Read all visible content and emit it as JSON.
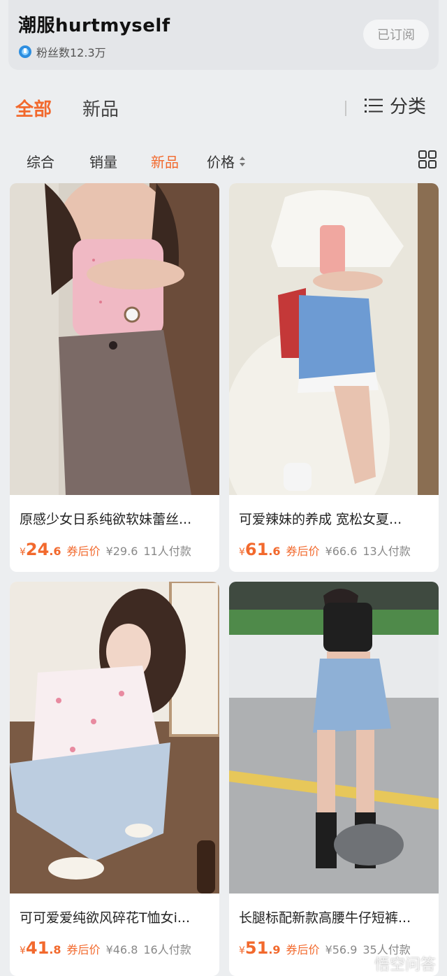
{
  "shop": {
    "name": "潮服hurtmyself",
    "fans_label": "粉丝数12.3万",
    "subscribe_label": "已订阅"
  },
  "tabs": {
    "all": "全部",
    "new": "新品",
    "category": "分类"
  },
  "sort": {
    "zonghe": "综合",
    "xiaoliang": "销量",
    "xinpin": "新品",
    "jiage": "价格"
  },
  "products": [
    {
      "title": "原感少女日系纯欲软妹蕾丝...",
      "yen": "¥",
      "price_int": "24",
      "price_dec": ".6",
      "coupon_label": "券后价",
      "orig_price": "¥29.6",
      "paid": "11人付款"
    },
    {
      "title": "可爱辣妹的养成 宽松女夏...",
      "yen": "¥",
      "price_int": "61",
      "price_dec": ".6",
      "coupon_label": "券后价",
      "orig_price": "¥66.6",
      "paid": "13人付款"
    },
    {
      "title": "可可爱爱纯欲风碎花T恤女i...",
      "yen": "¥",
      "price_int": "41",
      "price_dec": ".8",
      "coupon_label": "券后价",
      "orig_price": "¥46.8",
      "paid": "16人付款"
    },
    {
      "title": "长腿标配新款高腰牛仔短裤...",
      "yen": "¥",
      "price_int": "51",
      "price_dec": ".9",
      "coupon_label": "券后价",
      "orig_price": "¥56.9",
      "paid": "35人付款"
    }
  ],
  "watermark": "悟空问答",
  "colors": {
    "accent": "#f2692d",
    "background": "#eceef0",
    "card": "#ffffff"
  }
}
